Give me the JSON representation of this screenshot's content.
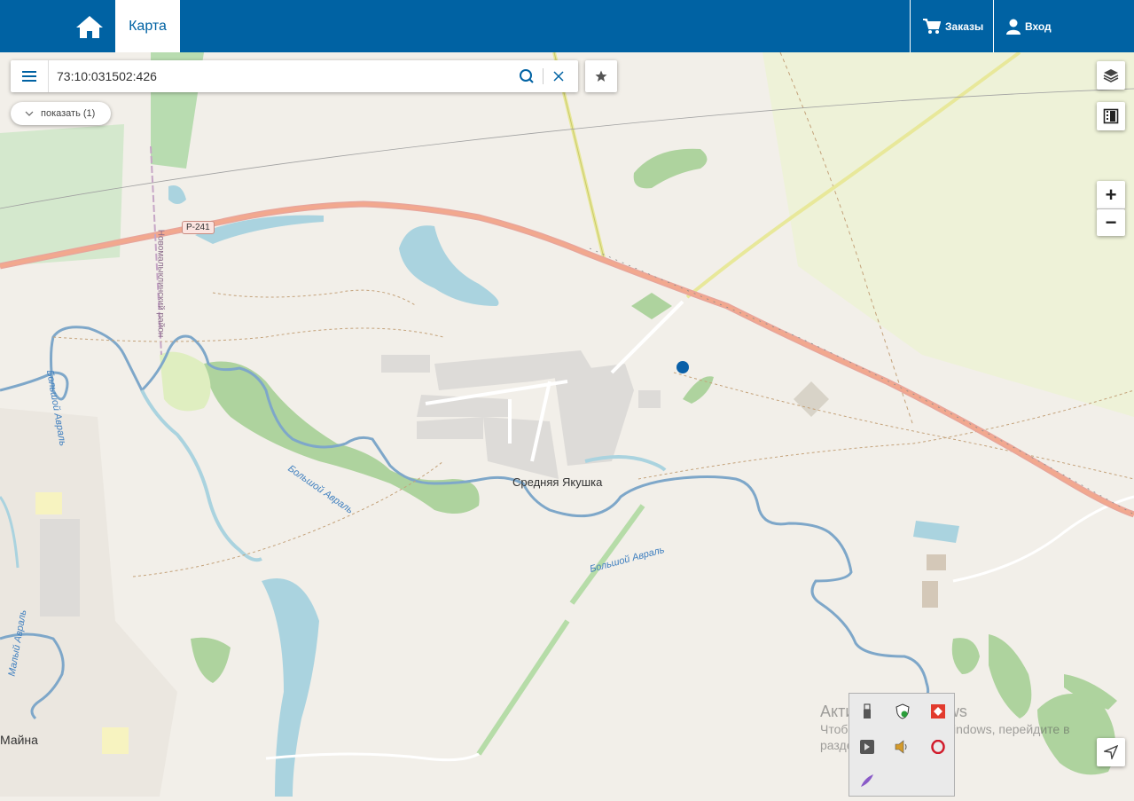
{
  "header": {
    "map_tab_label": "Карта",
    "orders_label": "Заказы",
    "login_label": "Вход",
    "brand_color": "#0062a3"
  },
  "search": {
    "value": "73:10:031502:426",
    "icons": [
      "menu-icon",
      "search-icon",
      "close-icon",
      "star-icon"
    ]
  },
  "results": {
    "show_label": "показать (1)"
  },
  "controls": {
    "zoom_in_label": "+",
    "zoom_out_label": "−",
    "icons": [
      "layers-icon",
      "filmstrip-icon",
      "locate-icon"
    ]
  },
  "map_labels": {
    "village": "Средняя Якушка",
    "town": "Майна",
    "road": "Р-241",
    "district": "Новомалыклинский район",
    "river_1": "Большой Авраль",
    "river_2": "Большой Авраль",
    "river_3": "Малый Авраль",
    "river_4": "Большой Авраль"
  },
  "watermark": {
    "title": "Активация Windows",
    "subtitle": "Чтобы активировать Windows, перейдите в раздел \"Параметры\"."
  },
  "marker": {
    "color": "#0a60a8"
  }
}
